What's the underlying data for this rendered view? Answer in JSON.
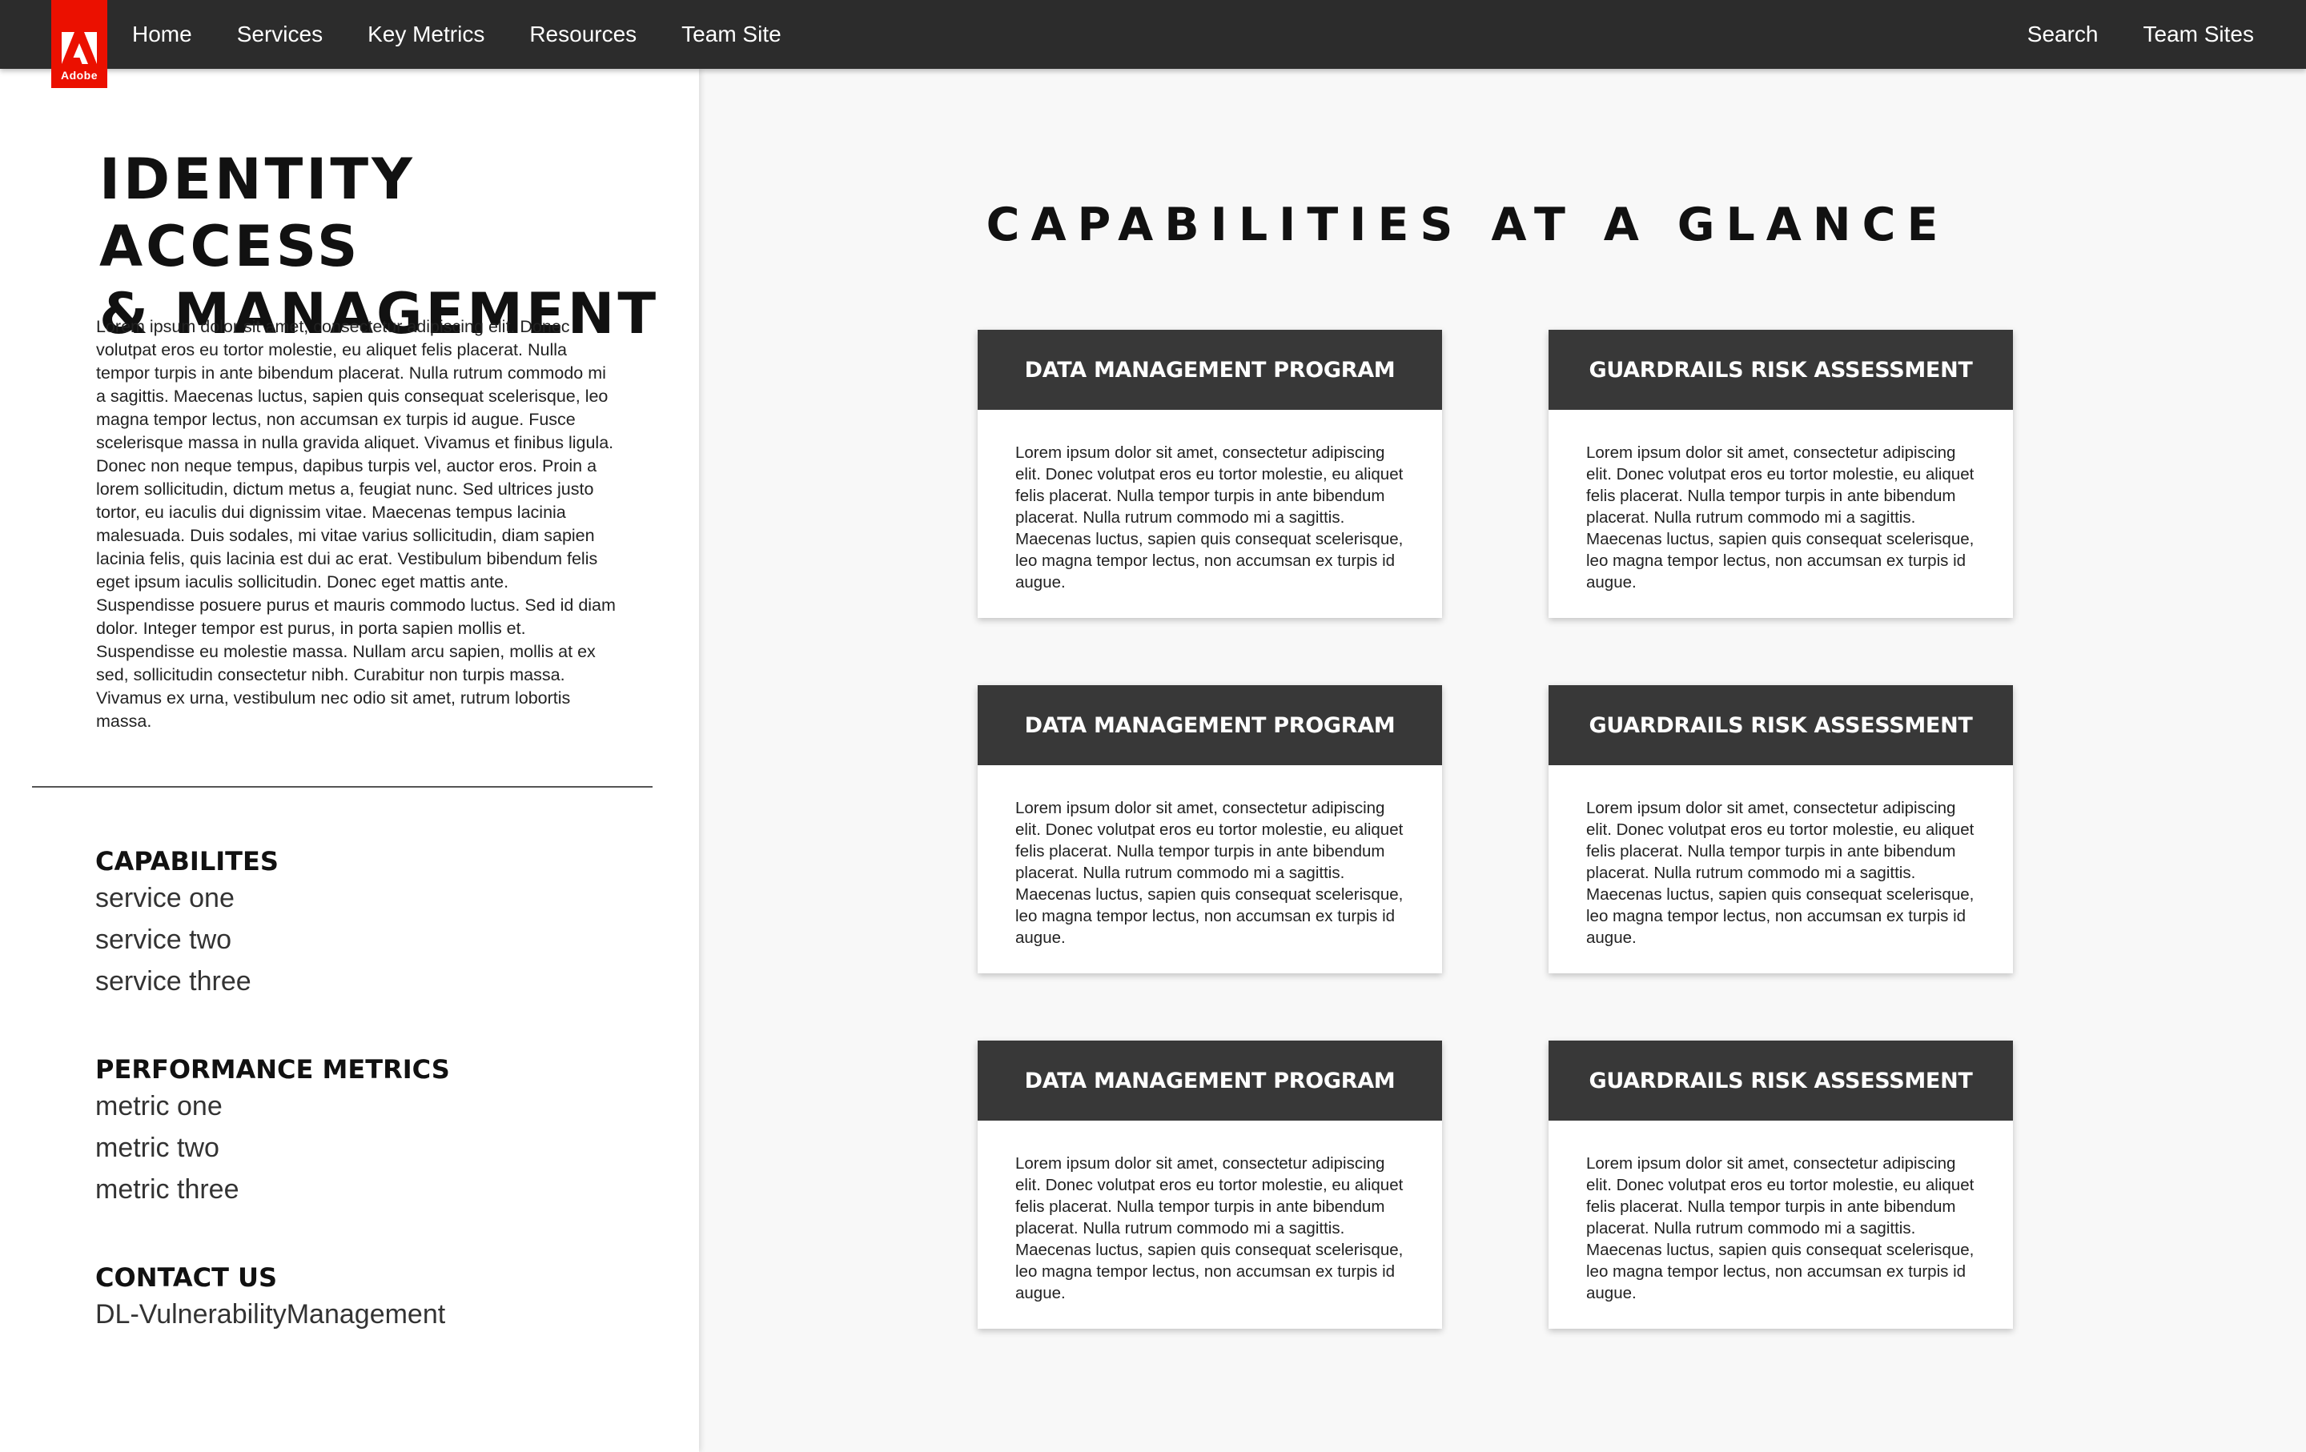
{
  "brand": {
    "logo_text": "Adobe",
    "accent": "#eb1000"
  },
  "nav": {
    "left": [
      "Home",
      "Services",
      "Key Metrics",
      "Resources",
      "Team Site"
    ],
    "right": [
      "Search",
      "Team Sites"
    ]
  },
  "sidebar": {
    "title_line1": "IDENTITY ACCESS",
    "title_line2": "& MANAGEMENT",
    "intro_p1": "Lorem ipsum dolor sit amet, consectetur adipiscing elit. Donec volutpat eros eu tortor molestie, eu aliquet felis placerat. Nulla tempor turpis in ante bibendum placerat. Nulla rutrum commodo mi a sagittis. Maecenas luctus, sapien quis consequat scelerisque, leo magna tempor lectus, non accumsan ex turpis id augue. Fusce scelerisque massa in nulla gravida aliquet. Vivamus et finibus ligula. Donec non neque tempus, dapibus turpis vel, auctor eros. Proin a lorem sollicitudin, dictum metus a, feugiat nunc. Sed ultrices justo tortor, eu iaculis dui dignissim vitae. Maecenas tempus lacinia malesuada. Duis sodales, mi vitae varius sollicitudin, diam sapien lacinia felis, quis lacinia est dui ac erat. Vestibulum bibendum felis eget ipsum iaculis sollicitudin. Donec eget mattis ante.",
    "intro_p2": "Suspendisse posuere purus et mauris commodo luctus. Sed id diam dolor. Integer tempor est purus, in porta sapien mollis et. Suspendisse eu molestie massa. Nullam arcu sapien, mollis at ex sed, sollicitudin consectetur nibh. Curabitur non turpis massa. Vivamus ex urna, vestibulum nec odio sit amet, rutrum lobortis massa.",
    "capabilities": {
      "heading": "CAPABILITES",
      "items": [
        "service one",
        "service two",
        "service three"
      ]
    },
    "metrics": {
      "heading": "PERFORMANCE METRICS",
      "items": [
        "metric one",
        "metric two",
        "metric three"
      ]
    },
    "contact": {
      "heading": "CONTACT US",
      "value": "DL-VulnerabilityManagement"
    }
  },
  "main": {
    "title": "CAPABILITIES AT A GLANCE",
    "cards": [
      {
        "title": "DATA MANAGEMENT PROGRAM",
        "body": "Lorem ipsum dolor sit amet, consectetur adipiscing elit. Donec volutpat eros eu tortor molestie, eu aliquet felis placerat. Nulla tempor turpis in ante bibendum placerat. Nulla rutrum commodo mi a sagittis. Maecenas luctus, sapien quis consequat scelerisque, leo magna tempor lectus, non accumsan ex turpis id augue."
      },
      {
        "title": "GUARDRAILS RISK ASSESSMENT",
        "body": "Lorem ipsum dolor sit amet, consectetur adipiscing elit. Donec volutpat eros eu tortor molestie, eu aliquet felis placerat. Nulla tempor turpis in ante bibendum placerat. Nulla rutrum commodo mi a sagittis. Maecenas luctus, sapien quis consequat scelerisque, leo magna tempor lectus, non accumsan ex turpis id augue."
      },
      {
        "title": "DATA MANAGEMENT PROGRAM",
        "body": "Lorem ipsum dolor sit amet, consectetur adipiscing elit. Donec volutpat eros eu tortor molestie, eu aliquet felis placerat. Nulla tempor turpis in ante bibendum placerat. Nulla rutrum commodo mi a sagittis. Maecenas luctus, sapien quis consequat scelerisque, leo magna tempor lectus, non accumsan ex turpis id augue."
      },
      {
        "title": "GUARDRAILS RISK ASSESSMENT",
        "body": "Lorem ipsum dolor sit amet, consectetur adipiscing elit. Donec volutpat eros eu tortor molestie, eu aliquet felis placerat. Nulla tempor turpis in ante bibendum placerat. Nulla rutrum commodo mi a sagittis. Maecenas luctus, sapien quis consequat scelerisque, leo magna tempor lectus, non accumsan ex turpis id augue."
      },
      {
        "title": "DATA MANAGEMENT PROGRAM",
        "body": "Lorem ipsum dolor sit amet, consectetur adipiscing elit. Donec volutpat eros eu tortor molestie, eu aliquet felis placerat. Nulla tempor turpis in ante bibendum placerat. Nulla rutrum commodo mi a sagittis. Maecenas luctus, sapien quis consequat scelerisque, leo magna tempor lectus, non accumsan ex turpis id augue."
      },
      {
        "title": "GUARDRAILS RISK ASSESSMENT",
        "body": "Lorem ipsum dolor sit amet, consectetur adipiscing elit. Donec volutpat eros eu tortor molestie, eu aliquet felis placerat. Nulla tempor turpis in ante bibendum placerat. Nulla rutrum commodo mi a sagittis. Maecenas luctus, sapien quis consequat scelerisque, leo magna tempor lectus, non accumsan ex turpis id augue."
      }
    ]
  }
}
